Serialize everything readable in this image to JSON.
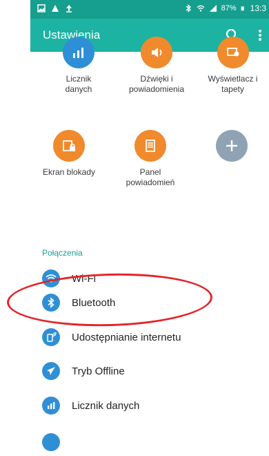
{
  "status_bar": {
    "battery": "87%",
    "time": "13:3"
  },
  "app_bar": {
    "title": "Ustawienia"
  },
  "shortcuts": [
    {
      "label": "Licznik danych",
      "icon": "data-usage-icon",
      "color": "#2f8fd6"
    },
    {
      "label": "Dźwięki i powiadomienia",
      "icon": "volume-icon",
      "color": "#f08a2c"
    },
    {
      "label": "Wyświetlacz i tapety",
      "icon": "display-icon",
      "color": "#f08a2c"
    },
    {
      "label": "Ekran blokady",
      "icon": "lock-screen-icon",
      "color": "#f08a2c"
    },
    {
      "label": "Panel powiadomień",
      "icon": "notification-panel-icon",
      "color": "#f08a2c"
    },
    {
      "label": "",
      "icon": "add-icon",
      "color": "#8fa3b4"
    }
  ],
  "section": {
    "title": "Połączenia"
  },
  "list": [
    {
      "label": "Wi-Fi",
      "icon": "wifi-icon",
      "color": "#2f8fd6"
    },
    {
      "label": "Bluetooth",
      "icon": "bluetooth-icon",
      "color": "#2f8fd6"
    },
    {
      "label": "Udostępnianie internetu",
      "icon": "tethering-icon",
      "color": "#2f8fd6"
    },
    {
      "label": "Tryb Offline",
      "icon": "airplane-icon",
      "color": "#2f8fd6"
    },
    {
      "label": "Licznik danych",
      "icon": "data-usage-icon",
      "color": "#2f8fd6"
    }
  ],
  "colors": {
    "status_bar": "#169f8f",
    "app_bar": "#1cb3a2",
    "annotation": "#e3242b"
  }
}
